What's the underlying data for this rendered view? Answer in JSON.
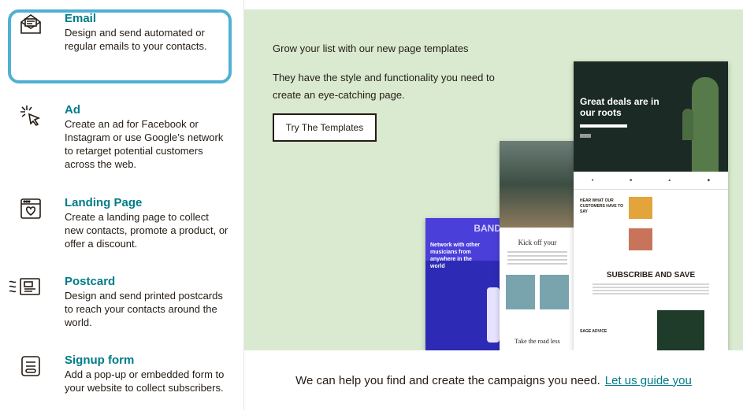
{
  "options": [
    {
      "title": "Email",
      "desc": "Design and send automated or regular emails to your contacts.",
      "icon": "email-icon"
    },
    {
      "title": "Ad",
      "desc": "Create an ad for Facebook or Instagram or use Google’s network to retarget potential customers across the web.",
      "icon": "cursor-click-icon"
    },
    {
      "title": "Landing Page",
      "desc": "Create a landing page to collect new contacts, promote a product, or offer a discount.",
      "icon": "landing-page-icon"
    },
    {
      "title": "Postcard",
      "desc": "Design and send printed postcards to reach your contacts around the world.",
      "icon": "postcard-icon"
    },
    {
      "title": "Signup form",
      "desc": "Add a pop-up or embedded form to your website to collect subscribers.",
      "icon": "signup-form-icon"
    }
  ],
  "banner": {
    "heading": "Grow your list with our new page templates",
    "subtext": "They have the style and functionality you need to create an eye-catching page.",
    "button": "Try The Templates",
    "mock": {
      "band_big": "BAND",
      "band_text": "Network with other musicians from anywhere in the world",
      "kick_off": "Kick off your",
      "road": "Take the road less",
      "great_deals": "Great deals are in our roots",
      "hear": "HEAR WHAT OUR CUSTOMERS HAVE TO SAY",
      "subscribe": "SUBSCRIBE AND SAVE",
      "sage": "SAGE ADVICE"
    }
  },
  "footer": {
    "text": "We can help you find and create the campaigns you need.",
    "link": "Let us guide you"
  },
  "colors": {
    "accent": "#007c89",
    "selection": "#4fb0d2",
    "banner_bg": "#d9ead0"
  }
}
